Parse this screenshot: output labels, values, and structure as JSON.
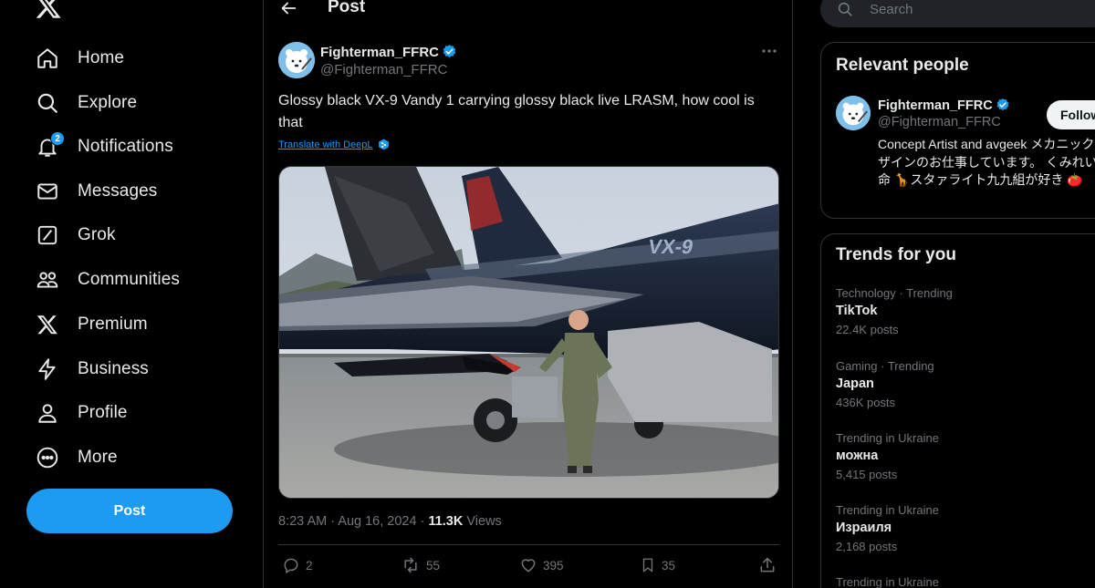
{
  "nav": {
    "items": [
      {
        "key": "home",
        "label": "Home",
        "icon": "home-icon"
      },
      {
        "key": "explore",
        "label": "Explore",
        "icon": "search-icon"
      },
      {
        "key": "notifications",
        "label": "Notifications",
        "icon": "bell-icon",
        "badge": "2"
      },
      {
        "key": "messages",
        "label": "Messages",
        "icon": "envelope-icon"
      },
      {
        "key": "grok",
        "label": "Grok",
        "icon": "grok-icon"
      },
      {
        "key": "communities",
        "label": "Communities",
        "icon": "people-icon"
      },
      {
        "key": "premium",
        "label": "Premium",
        "icon": "x-icon"
      },
      {
        "key": "business",
        "label": "Business",
        "icon": "lightning-icon"
      },
      {
        "key": "profile",
        "label": "Profile",
        "icon": "person-icon"
      },
      {
        "key": "more",
        "label": "More",
        "icon": "more-circle-icon"
      }
    ],
    "post_label": "Post"
  },
  "header": {
    "title": "Post"
  },
  "tweet": {
    "author_name": "Fighterman_FFRC",
    "author_handle": "@Fighterman_FFRC",
    "text": "Glossy black VX-9 Vandy 1 carrying glossy black live LRASM, how cool is that",
    "translate_label": "Translate with DeepL",
    "time": "8:23 AM · Aug 16, 2024 · ",
    "views_count": "11.3K",
    "views_label": " Views",
    "replies": "2",
    "reposts": "55",
    "likes": "395",
    "bookmarks": "35"
  },
  "search": {
    "placeholder": "Search"
  },
  "relevant": {
    "title": "Relevant people",
    "name": "Fighterman_FFRC",
    "handle": "@Fighterman_FFRC",
    "follow_label": "Follow",
    "bio": "Concept Artist and avgeek メカニックデザインのお仕事しています。 くみれいは命 🦒スタァライト九九組が好き 🍅"
  },
  "trends": {
    "title": "Trends for you",
    "items": [
      {
        "category": "Technology · Trending",
        "name": "TikTok",
        "posts": "22.4K posts"
      },
      {
        "category": "Gaming · Trending",
        "name": "Japan",
        "posts": "436K posts"
      },
      {
        "category": "Trending in Ukraine",
        "name": "можна",
        "posts": "5,415 posts"
      },
      {
        "category": "Trending in Ukraine",
        "name": "Израиля",
        "posts": "2,168 posts"
      },
      {
        "category": "Trending in Ukraine",
        "name": "",
        "posts": ""
      }
    ]
  },
  "colors": {
    "accent": "#1d9bf0",
    "background": "#000000",
    "text": "#e7e9ea",
    "muted": "#71767b",
    "border": "#2f3336"
  }
}
